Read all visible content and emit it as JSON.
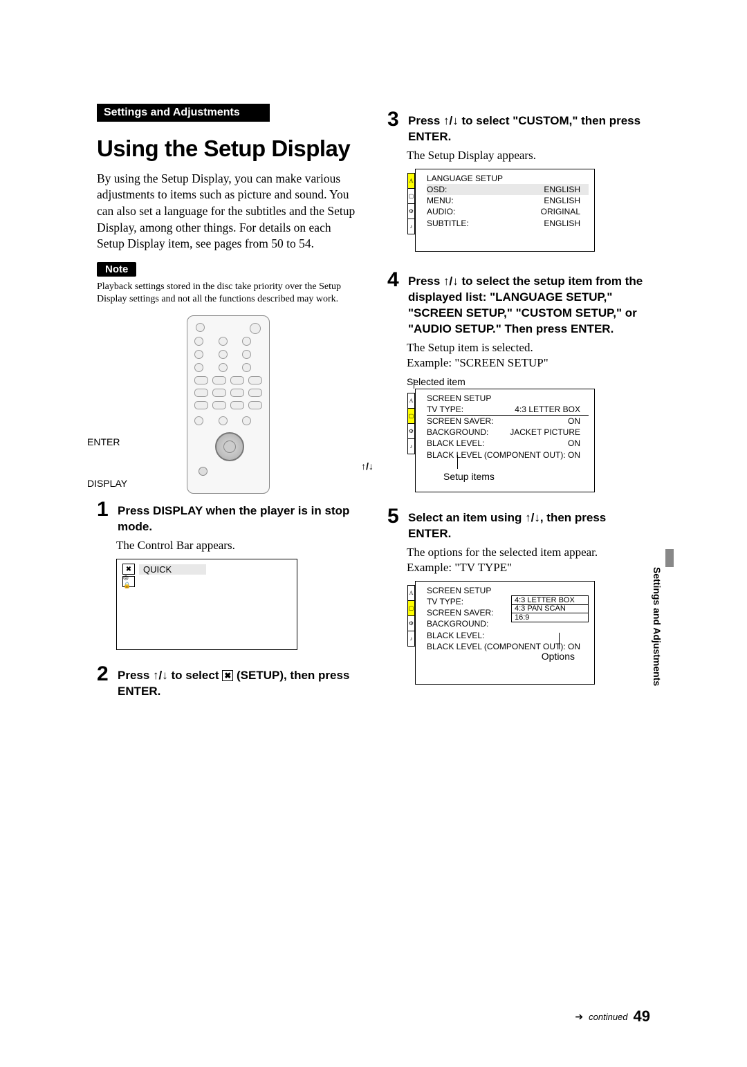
{
  "section_band": "Settings and Adjustments",
  "title": "Using the Setup Display",
  "intro": "By using the Setup Display, you can make various adjustments to items such as picture and sound. You can also set a language for the subtitles and the Setup Display, among other things. For details on each Setup Display item, see pages from 50 to 54.",
  "note_label": "Note",
  "note_text": "Playback settings stored in the disc take priority over the Setup Display settings and not all the functions described may work.",
  "remote_labels": {
    "enter": "ENTER",
    "display": "DISPLAY",
    "updown": "↑/↓"
  },
  "steps": {
    "s1": {
      "num": "1",
      "head": "Press DISPLAY when the player is in stop mode.",
      "body": "The Control Bar appears.",
      "quick": "QUICK"
    },
    "s2": {
      "num": "2",
      "head_pre": "Press ",
      "arrows": "↑/↓",
      "head_mid": " to select ",
      "setup": " (SETUP), then press ENTER."
    },
    "s3": {
      "num": "3",
      "head_pre": "Press ",
      "arrows": "↑/↓",
      "head_post": " to select \"CUSTOM,\" then press ENTER.",
      "body": "The Setup Display appears.",
      "menu": {
        "title": "LANGUAGE SETUP",
        "rows": [
          {
            "k": "OSD:",
            "v": "ENGLISH"
          },
          {
            "k": "MENU:",
            "v": "ENGLISH"
          },
          {
            "k": "AUDIO:",
            "v": "ORIGINAL"
          },
          {
            "k": "SUBTITLE:",
            "v": "ENGLISH"
          }
        ]
      }
    },
    "s4": {
      "num": "4",
      "head_pre": "Press ",
      "arrows": "↑/↓",
      "head_post": " to select the setup item from the displayed list: \"LANGUAGE SETUP,\" \"SCREEN SETUP,\" \"CUSTOM SETUP,\" or \"AUDIO SETUP.\" Then press ENTER.",
      "body": "The Setup item is selected.\nExample: \"SCREEN SETUP\"",
      "selected_label": "Selected item",
      "setup_items_label": "Setup items",
      "menu": {
        "title": "SCREEN SETUP",
        "rows": [
          {
            "k": "TV TYPE:",
            "v": "4:3 LETTER BOX"
          },
          {
            "k": "SCREEN SAVER:",
            "v": "ON"
          },
          {
            "k": "BACKGROUND:",
            "v": "JACKET PICTURE"
          },
          {
            "k": "BLACK LEVEL:",
            "v": "ON"
          },
          {
            "k": "BLACK LEVEL (COMPONENT OUT):",
            "v": "ON",
            "small": true
          }
        ]
      }
    },
    "s5": {
      "num": "5",
      "head_pre": "Select an item using ",
      "arrows": "↑/↓",
      "head_post": ", then press ENTER.",
      "body": "The options for the selected item appear.\nExample: \"TV TYPE\"",
      "options_label": "Options",
      "menu": {
        "title": "SCREEN SETUP",
        "rows": [
          {
            "k": "TV TYPE:",
            "v": "4:3 LETTER BOX"
          },
          {
            "k": "SCREEN SAVER:",
            "v": ""
          },
          {
            "k": "BACKGROUND:",
            "v": ""
          },
          {
            "k": "BLACK LEVEL:",
            "v": ""
          },
          {
            "k": "BLACK LEVEL (COMPONENT OUT):",
            "v": "ON",
            "small": true
          }
        ],
        "options": [
          "4:3 LETTER BOX",
          "4:3 PAN SCAN",
          "16:9"
        ]
      }
    }
  },
  "side_tab": "Settings and Adjustments",
  "footer": {
    "continued": "continued",
    "page": "49"
  }
}
